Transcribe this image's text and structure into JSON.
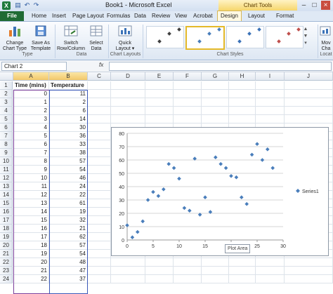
{
  "window": {
    "title": "Book1 - Microsoft Excel",
    "app_icon": "excel-icon",
    "qat_icons": [
      "save-icon",
      "undo-icon",
      "redo-icon"
    ],
    "controls": [
      "minimize-icon",
      "restore-icon",
      "close-icon"
    ]
  },
  "context_banner": "Chart Tools",
  "tabs": [
    "File",
    "Home",
    "Insert",
    "Page Layout",
    "Formulas",
    "Data",
    "Review",
    "View",
    "Acrobat",
    "Design",
    "Layout",
    "Format"
  ],
  "active_tab": "Design",
  "ribbon": {
    "buttons": [
      {
        "label_1": "Change",
        "label_2": "Chart Type",
        "icon": "change-chart-type-icon"
      },
      {
        "label_1": "Save As",
        "label_2": "Template",
        "icon": "save-as-template-icon"
      },
      {
        "label_1": "Switch",
        "label_2": "Row/Column",
        "icon": "switch-row-column-icon"
      },
      {
        "label_1": "Select",
        "label_2": "Data",
        "icon": "select-data-icon"
      },
      {
        "label_1": "Quick",
        "label_2": "Layout ▾",
        "icon": "quick-layout-icon"
      },
      {
        "label_1": "Mov",
        "label_2": "Cha",
        "icon": "move-chart-icon"
      }
    ],
    "groups": [
      "Type",
      "Data",
      "Chart Layouts",
      "Chart Styles",
      "Locat"
    ]
  },
  "formula_bar": {
    "name_box": "Chart 2",
    "fx": "fx",
    "value": ""
  },
  "columns": [
    "A",
    "B",
    "C",
    "D",
    "E",
    "F",
    "G",
    "H",
    "I",
    "J"
  ],
  "selected_columns": [
    "A",
    "B"
  ],
  "rows": [
    1,
    2,
    3,
    4,
    5,
    6,
    7,
    8,
    9,
    10,
    11,
    12,
    13,
    14,
    15,
    16,
    17,
    18,
    19,
    20,
    21,
    22,
    23,
    24
  ],
  "table": {
    "headers": [
      "Time (mins)",
      "Temperature"
    ],
    "data": [
      [
        0,
        11
      ],
      [
        1,
        2
      ],
      [
        2,
        6
      ],
      [
        3,
        14
      ],
      [
        4,
        30
      ],
      [
        5,
        36
      ],
      [
        6,
        33
      ],
      [
        7,
        38
      ],
      [
        8,
        57
      ],
      [
        9,
        54
      ],
      [
        10,
        46
      ],
      [
        11,
        24
      ],
      [
        12,
        22
      ],
      [
        13,
        61
      ],
      [
        14,
        19
      ],
      [
        15,
        32
      ],
      [
        16,
        21
      ],
      [
        17,
        62
      ],
      [
        18,
        57
      ],
      [
        19,
        54
      ],
      [
        20,
        48
      ],
      [
        21,
        47
      ],
      [
        22,
        37
      ]
    ]
  },
  "chart_data": {
    "type": "scatter",
    "series": [
      {
        "name": "Series1",
        "color": "#4a7ebb",
        "x": [
          0,
          1,
          2,
          3,
          4,
          5,
          6,
          7,
          8,
          9,
          10,
          11,
          12,
          13,
          14,
          15,
          16,
          17,
          18,
          19,
          20,
          21,
          22,
          23,
          24,
          25,
          26,
          27,
          28
        ],
        "y": [
          11,
          2,
          6,
          14,
          30,
          36,
          33,
          38,
          57,
          54,
          46,
          24,
          22,
          61,
          19,
          32,
          21,
          62,
          57,
          54,
          48,
          47,
          32,
          27,
          64,
          72,
          60,
          68,
          54
        ]
      }
    ],
    "xlim": [
      0,
      30
    ],
    "ylim": [
      0,
      80
    ],
    "x_ticks": [
      0,
      5,
      10,
      15,
      20,
      25,
      30
    ],
    "y_ticks": [
      0,
      10,
      20,
      30,
      40,
      50,
      60,
      70,
      80
    ],
    "grid": "horizontal",
    "legend": "right",
    "tooltip": "Plot Area"
  }
}
